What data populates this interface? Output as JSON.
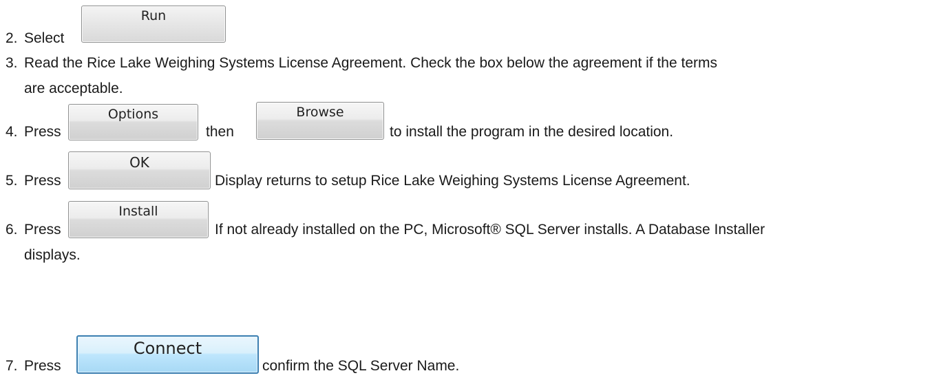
{
  "steps": [
    {
      "number": "2.",
      "pre": "Select",
      "button": "Run",
      "post": ""
    },
    {
      "number": "3.",
      "line1": "Read the Rice Lake Weighing Systems License Agreement. Check the box below the agreement if the terms",
      "line2": "are acceptable."
    },
    {
      "number": "4.",
      "pre": "Press",
      "button1": "Options",
      "mid": "then",
      "button2": "Browse",
      "post": "to install the program in the desired location."
    },
    {
      "number": "5.",
      "pre": "Press",
      "button": "OK",
      "post": "Display returns to setup Rice Lake Weighing Systems License Agreement."
    },
    {
      "number": "6.",
      "pre": "Press",
      "button": "Install",
      "post": "If not already installed on the PC, Microsoft® SQL Server installs. A Database Installer",
      "line2": "displays."
    },
    {
      "number": "7.",
      "pre": "Press",
      "button": "Connect",
      "post": "confirm the SQL Server Name."
    }
  ]
}
